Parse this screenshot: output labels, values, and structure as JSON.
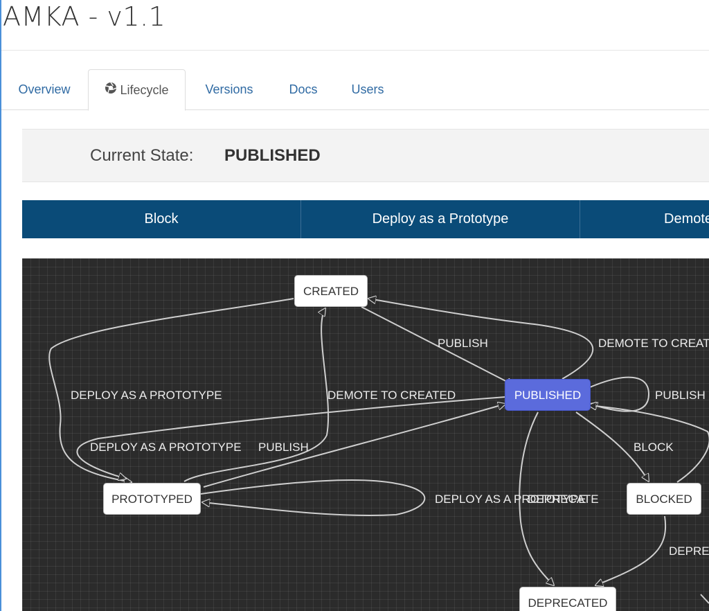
{
  "app": {
    "title": "AMKA - v1.1"
  },
  "tabs": [
    {
      "label": "Overview",
      "active": false
    },
    {
      "label": "Lifecycle",
      "active": true,
      "icon": "lifecycle-icon"
    },
    {
      "label": "Versions",
      "active": false
    },
    {
      "label": "Docs",
      "active": false
    },
    {
      "label": "Users",
      "active": false
    }
  ],
  "state": {
    "label": "Current State:",
    "value": "PUBLISHED"
  },
  "actions": [
    {
      "label": "Block"
    },
    {
      "label": "Deploy as a Prototype"
    },
    {
      "label": "Demote"
    }
  ],
  "lifecycle": {
    "nodes": {
      "created": "CREATED",
      "published": "PUBLISHED",
      "prototyped": "PROTOTYPED",
      "blocked": "BLOCKED",
      "deprecated": "DEPRECATED"
    },
    "edges": {
      "publish_top": "PUBLISH",
      "demote_to_created_right": "DEMOTE TO CREAT",
      "deploy_prototype_left": "DEPLOY AS A PROTOTYPE",
      "demote_to_created_mid": "DEMOTE TO CREATED",
      "publish_self": "PUBLISH",
      "deploy_prototype_lower": "DEPLOY AS A PROTOTYPE",
      "publish_lower": "PUBLISH",
      "block": "BLOCK",
      "deploy_prototype_self": "DEPLOY AS A PROTOTYPE",
      "deprecate_mid": "DEPRECATE",
      "deprecate_right": "DEPRE"
    },
    "colors": {
      "current": "#5b6bdc",
      "canvas": "#2b2b2b",
      "edge": "#cfcfcf"
    }
  }
}
